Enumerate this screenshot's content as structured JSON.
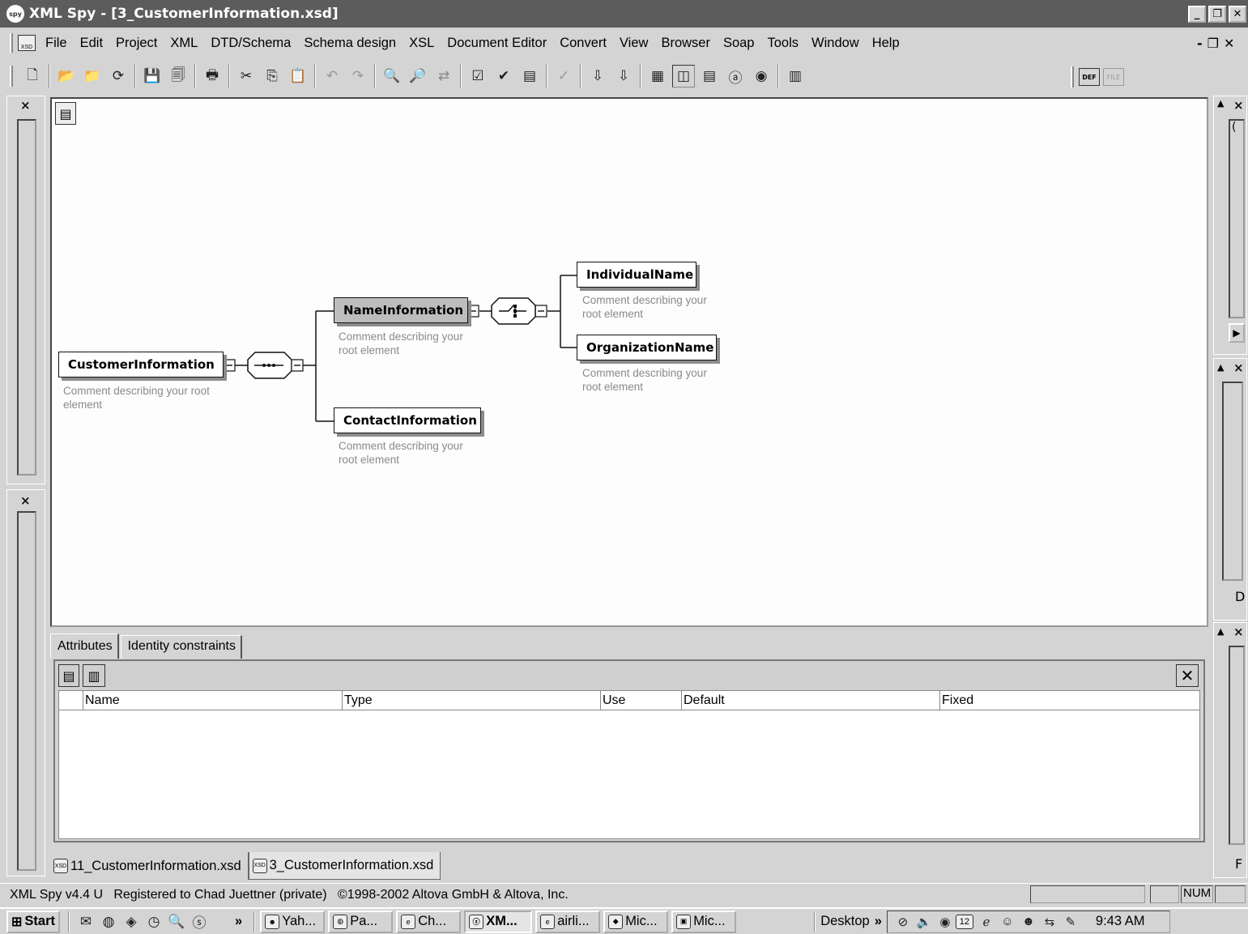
{
  "window": {
    "title": "XML Spy - [3_CustomerInformation.xsd]",
    "app_icon": "spy"
  },
  "menu": {
    "items": [
      "File",
      "Edit",
      "Project",
      "XML",
      "DTD/Schema",
      "Schema design",
      "XSL",
      "Document Editor",
      "Convert",
      "View",
      "Browser",
      "Soap",
      "Tools",
      "Window",
      "Help"
    ],
    "xsd_icon": "XSD"
  },
  "toolbar": {
    "icons": [
      "new-icon",
      "open-icon",
      "open-url-icon",
      "reload-icon",
      "save-icon",
      "save-all-icon",
      "print-icon",
      "cut-icon",
      "copy-icon",
      "paste-icon",
      "undo-icon",
      "redo-icon",
      "find-icon",
      "find-next-icon",
      "replace-icon",
      "check-wellformed-icon",
      "validate-icon",
      "dtd-icon",
      "spellcheck-icon",
      "xsl-transform-icon",
      "fo-transform-icon",
      "enhanced-grid-icon",
      "schema-design-icon",
      "text-view-icon",
      "authentic-view-icon",
      "browser-view-icon",
      "toggle-panel-icon"
    ],
    "right_icons": [
      {
        "label": "DEF"
      },
      {
        "label": "FILE"
      }
    ]
  },
  "diagram": {
    "nodes": [
      {
        "name": "CustomerInformation",
        "comment": "Comment describing your root element"
      },
      {
        "name": "NameInformation",
        "comment": "Comment describing your root element"
      },
      {
        "name": "ContactInformation",
        "comment": "Comment describing your root element"
      },
      {
        "name": "IndividualName",
        "comment": "Comment describing your root element"
      },
      {
        "name": "OrganizationName",
        "comment": "Comment describing your root element"
      }
    ],
    "compositors": [
      {
        "type": "sequence",
        "icon": "sequence-icon"
      },
      {
        "type": "choice",
        "icon": "choice-icon"
      }
    ]
  },
  "attributes_panel": {
    "tabs": [
      "Attributes",
      "Identity constraints"
    ],
    "columns": [
      "Name",
      "Type",
      "Use",
      "Default",
      "Fixed"
    ]
  },
  "document_tabs": [
    {
      "label": "11_CustomerInformation.xsd",
      "icon": "XSD"
    },
    {
      "label": "3_CustomerInformation.xsd",
      "icon": "XSD",
      "active": true
    }
  ],
  "right_panel": {
    "letters_top": "(",
    "letters_mid": "D",
    "letters_bottom": "F"
  },
  "status_bar": {
    "text": "XML Spy v4.4 U   Registered to Chad Juettner (private)   ©1998-2002 Altova GmbH & Altova, Inc.",
    "num": "NUM"
  },
  "taskbar": {
    "start": "Start",
    "buttons": [
      "Yah...",
      "Pa...",
      "Ch...",
      "XM...",
      "airli...",
      "Mic...",
      "Mic..."
    ],
    "active_button": "XM...",
    "desktop": "Desktop",
    "chevron": "»",
    "tray_date": "12",
    "clock": "9:43 AM"
  }
}
